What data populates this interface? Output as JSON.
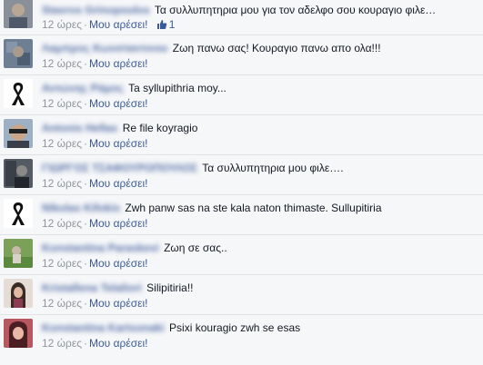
{
  "comments": [
    {
      "author": "Stavros Grinopoulos",
      "text": "Τα συλλυπητηρια μου για τον αδελφο σου κουραγιο φιλε…",
      "time": "12 ώρες",
      "like": "Μου αρέσει!",
      "likes": "1"
    },
    {
      "author": "Λαμπρος Κωνσταντινου",
      "text": "Ζωη πανω σας! Κουραγιο πανω απο ολα!!!",
      "time": "12 ώρες",
      "like": "Μου αρέσει!"
    },
    {
      "author": "Αντώνης Ράμος",
      "text": "Ta syllupithria moy...",
      "time": "12 ώρες",
      "like": "Μου αρέσει!"
    },
    {
      "author": "Antonis Hellas",
      "text": "Re file koyragio",
      "time": "12 ώρες",
      "like": "Μου αρέσει!"
    },
    {
      "author": "ΓΙΩΡΓΟΣ ΤΣΑΦΟΥΡΟΠΟΥΛΟΣ",
      "text": "Τα συλλυπητηρια μου φιλε….",
      "time": "12 ώρες",
      "like": "Μου αρέσει!"
    },
    {
      "author": "Nikolas Kifokis",
      "text": "Zwh panw sas na ste kala naton thimaste. Sullupitiria",
      "time": "12 ώρες",
      "like": "Μου αρέσει!"
    },
    {
      "author": "Konstantina Paraskevi",
      "text": "Ζωη σε σας..",
      "time": "12 ώρες",
      "like": "Μου αρέσει!"
    },
    {
      "author": "Kristallena Telaliori",
      "text": "Silipitiria!!",
      "time": "12 ώρες",
      "like": "Μου αρέσει!"
    },
    {
      "author": "Konstantina Kartsonaki",
      "text": "Psixi kouragio zwh se esas",
      "time": "12 ώρες",
      "like": "Μου αρέσει!"
    }
  ],
  "colors": {
    "link_blue": "#3b5998",
    "meta_gray": "#90949c",
    "background": "#f6f7f9",
    "divider": "#e1e2e3"
  },
  "icons": {
    "like_count": "thumbs-up-icon",
    "avatars": [
      "avatar-photo",
      "avatar-photo",
      "black-ribbon",
      "avatar-photo",
      "avatar-photo",
      "black-ribbon",
      "avatar-photo",
      "avatar-photo",
      "avatar-photo"
    ]
  }
}
